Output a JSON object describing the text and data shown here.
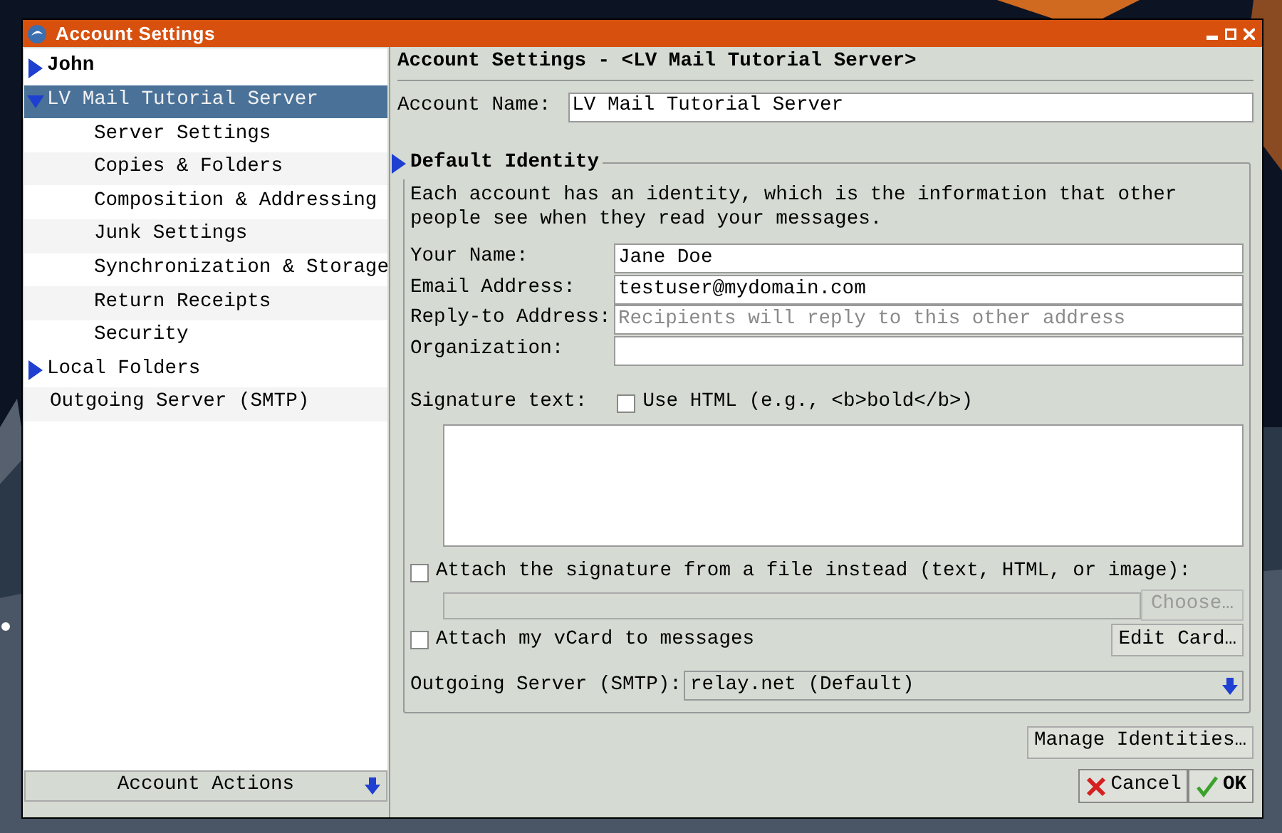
{
  "window": {
    "title": "Account Settings"
  },
  "sidebar": {
    "items": [
      {
        "label": "John",
        "bold": true,
        "expanded": false,
        "selected": false
      },
      {
        "label": "LV Mail Tutorial Server",
        "bold": false,
        "expanded": true,
        "selected": true,
        "children": [
          {
            "label": "Server Settings",
            "selected": false
          },
          {
            "label": "Copies & Folders",
            "selected": false
          },
          {
            "label": "Composition & Addressing",
            "selected": false
          },
          {
            "label": "Junk Settings",
            "selected": false
          },
          {
            "label": "Synchronization & Storage",
            "selected": false
          },
          {
            "label": "Return Receipts",
            "selected": false
          },
          {
            "label": "Security",
            "selected": false
          }
        ]
      },
      {
        "label": "Local Folders",
        "bold": false,
        "expanded": false,
        "selected": false
      },
      {
        "label": "Outgoing Server (SMTP)",
        "bold": false,
        "selected": false
      }
    ],
    "account_actions": "Account Actions"
  },
  "panel": {
    "heading": "Account Settings - <LV Mail Tutorial Server>",
    "account_name": {
      "label": "Account Name:",
      "value": "LV Mail Tutorial Server"
    },
    "identity": {
      "legend": "Default Identity",
      "description": "Each account has an identity, which is the information that other people see when they read your messages.",
      "fields": [
        {
          "label": "Your Name:",
          "value": "Jane Doe"
        },
        {
          "label": "Email Address:",
          "value": "testuser@mydomain.com"
        },
        {
          "label": "Reply-to Address:",
          "placeholder": "Recipients will reply to this other address"
        },
        {
          "label": "Organization:"
        }
      ],
      "signature": {
        "label": "Signature text:",
        "use_html": {
          "label": "Use HTML (e.g., <b>bold</b>)",
          "checked": false
        }
      },
      "attach_file": {
        "label": "Attach the signature from a file instead (text, HTML, or image):",
        "checked": false,
        "disabled": true,
        "choose_button": "Choose…"
      },
      "vcard": {
        "label": "Attach my vCard to messages",
        "checked": false,
        "edit_button": "Edit Card…"
      },
      "smtp": {
        "label": "Outgoing Server (SMTP):",
        "value": "relay.net (Default)"
      }
    },
    "manage_button": "Manage Identities…",
    "buttons": [
      {
        "label": "Cancel",
        "kind": "cancel"
      },
      {
        "label": "OK",
        "kind": "ok"
      }
    ]
  }
}
